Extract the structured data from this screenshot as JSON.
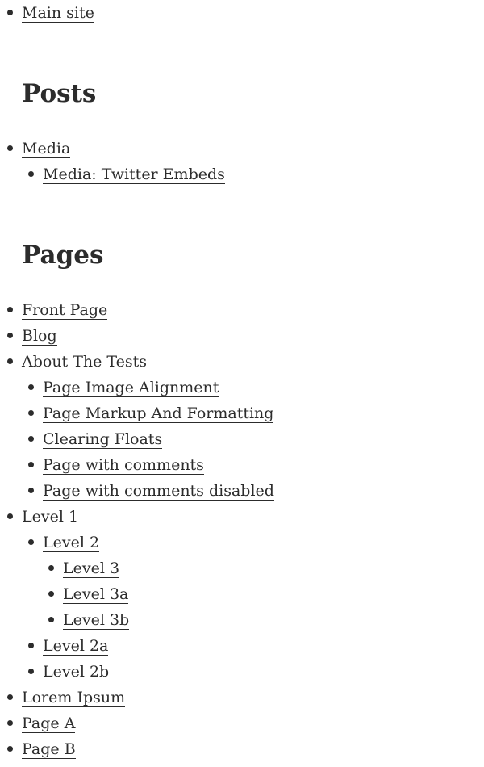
{
  "main_site": {
    "label": "Main site"
  },
  "posts": {
    "heading": "Posts",
    "items": [
      {
        "label": "Media"
      },
      {
        "label": "Media: Twitter Embeds"
      }
    ]
  },
  "pages": {
    "heading": "Pages",
    "items": [
      {
        "label": "Front Page"
      },
      {
        "label": "Blog"
      },
      {
        "label": "About The Tests"
      },
      {
        "label": "Page Image Alignment"
      },
      {
        "label": "Page Markup And Formatting"
      },
      {
        "label": "Clearing Floats"
      },
      {
        "label": "Page with comments"
      },
      {
        "label": "Page with comments disabled"
      },
      {
        "label": "Level 1"
      },
      {
        "label": "Level 2"
      },
      {
        "label": "Level 3"
      },
      {
        "label": "Level 3a"
      },
      {
        "label": "Level 3b"
      },
      {
        "label": "Level 2a"
      },
      {
        "label": "Level 2b"
      },
      {
        "label": "Lorem Ipsum"
      },
      {
        "label": "Page A"
      },
      {
        "label": "Page B"
      }
    ]
  }
}
